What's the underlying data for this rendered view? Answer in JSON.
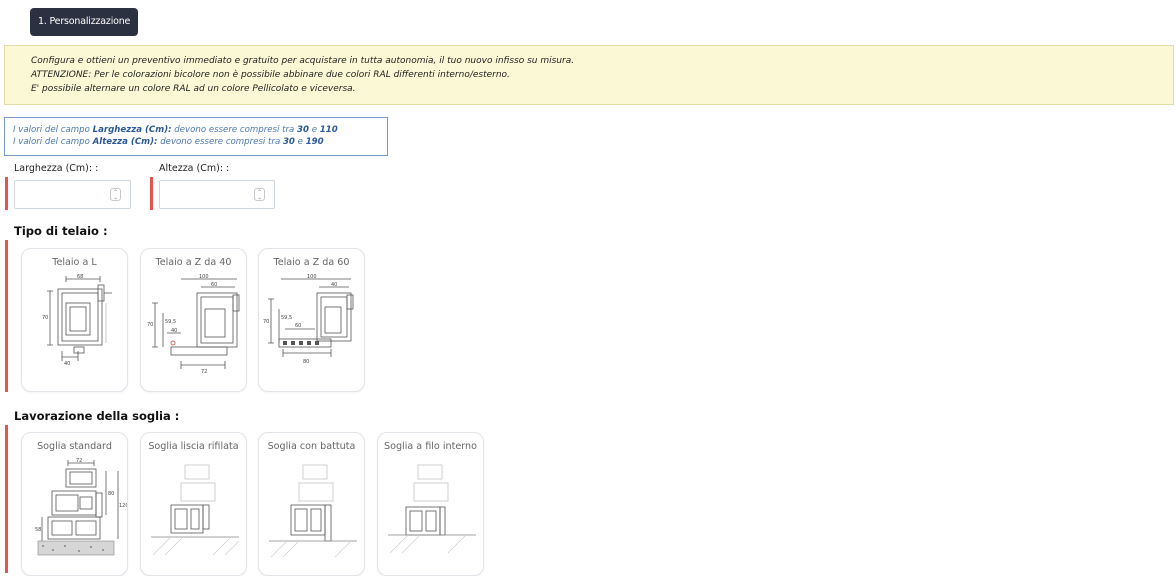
{
  "step": {
    "label": "1. Personalizzazione"
  },
  "notice": {
    "line1": "Configura e ottieni un preventivo immediato e gratuito per acquistare in tutta autonomia, il tuo nuovo infisso su misura.",
    "line2": "ATTENZIONE: Per le colorazioni bicolore non è possibile abbinare due colori RAL differenti interno/esterno.",
    "line3": "E' possibile alternare un colore RAL ad un colore Pellicolato e viceversa."
  },
  "ranges": {
    "width": {
      "prefix": "I valori del campo ",
      "field": "Larghezza (Cm):",
      "mid": " devono essere compresi tra ",
      "min": "30",
      "and": " e ",
      "max": "110"
    },
    "height": {
      "prefix": "I valori del campo ",
      "field": "Altezza (Cm):",
      "mid": " devono essere compresi tra ",
      "min": "30",
      "and": " e ",
      "max": "190"
    }
  },
  "fields": {
    "width": {
      "label": "Larghezza (Cm): :",
      "value": ""
    },
    "height": {
      "label": "Altezza (Cm): :",
      "value": ""
    }
  },
  "frame": {
    "title": "Tipo di telaio :",
    "options": [
      {
        "label": "Telaio a L",
        "icon": "frame-l-profile-diagram"
      },
      {
        "label": "Telaio a Z da 40",
        "icon": "frame-z40-profile-diagram"
      },
      {
        "label": "Telaio a Z da 60",
        "icon": "frame-z60-profile-diagram"
      }
    ]
  },
  "threshold": {
    "title": "Lavorazione della soglia :",
    "options": [
      {
        "label": "Soglia standard",
        "icon": "threshold-standard-diagram"
      },
      {
        "label": "Soglia liscia rifilata",
        "icon": "threshold-smooth-trimmed-diagram"
      },
      {
        "label": "Soglia con battuta",
        "icon": "threshold-rebated-diagram"
      },
      {
        "label": "Soglia a filo interno",
        "icon": "threshold-flush-internal-diagram"
      }
    ]
  },
  "diagram_dims": {
    "frame_l": [
      "68",
      "70",
      "40"
    ],
    "frame_z40": [
      "100",
      "60",
      "70",
      "59,5",
      "40",
      "72"
    ],
    "frame_z60": [
      "100",
      "40",
      "70",
      "59,5",
      "60",
      "80"
    ],
    "threshold_std": [
      "72",
      "80",
      "120",
      "58"
    ]
  },
  "colors": {
    "badge_bg": "#2b3140",
    "notice_bg": "#fbf8d6",
    "required_bar": "#e2564f",
    "range_text": "#4d78b0"
  }
}
